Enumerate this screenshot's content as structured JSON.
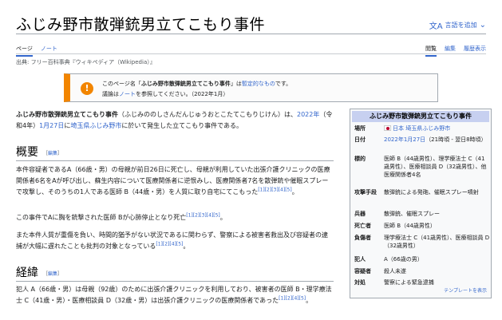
{
  "page": {
    "title": "ふじみ野市散弾銃男立てこもり事件",
    "lang_button": "言語を追加",
    "lang_icon": "translate-icon",
    "tabs_left": [
      "ページ",
      "ノート"
    ],
    "tabs_right": [
      "閲覧",
      "編集",
      "履歴表示"
    ],
    "source": "出典: フリー百科事典『ウィキペディア（Wikipedia）』"
  },
  "notice": {
    "icon": "!",
    "line1_pre": "このページ名「",
    "line1_name": "ふじみ野市散弾銃男立てこもり事件",
    "line1_mid": "」は",
    "line1_link": "暫定的なもの",
    "line1_post": "です。",
    "line2_pre": "議論は",
    "line2_link": "ノート",
    "line2_post": "を参照してください。（2022年1月）"
  },
  "intro": {
    "bold": "ふじみ野市散弾銃男立てこもり事件",
    "reading": "（ふじみののしさんだんじゅうおとこたてこもりじけん）は、",
    "date1": "2022年",
    "era": "（令和4年）",
    "date2": "1月27日",
    "mid": "に",
    "place": "埼玉県ふじみ野市",
    "tail": "に於いて発生した立てこもり事件である。"
  },
  "section1": {
    "heading": "概要",
    "edit_open": "［",
    "edit_label": "編集",
    "edit_close": "］",
    "p1": "本件容疑者であるA（66歳・男）の母親が前日26日に死亡し、母親が利用していた出張介護クリニックの医療関係者6名をAが呼び出し、蘇生内容について医療関係者に逆恨みし、医療関係者7名を散弾銃や催眠スプレーで攻撃し、そのうちの1人である医師 B（44歳・男）を人質に取り自宅にてこもった",
    "p1_refs": "[1][2][3][4][5]",
    "p1_end": "。",
    "p2": "この事件でAに胸を銃撃された医師 Bが心肺停止となり死亡",
    "p2_refs": "[1][2][3][4][5]",
    "p2_end": "。",
    "p3": "また本件人質が重傷を負い、時間的猶予がない状況であるに関わらず、警察による被害者救出及び容疑者の逮捕が大幅に遅れたことも批判の対象となっている",
    "p3_refs": "[1][2][4][5]",
    "p3_end": "。"
  },
  "section2": {
    "heading": "経緯",
    "edit_open": "［",
    "edit_label": "編集",
    "edit_close": "］",
    "p1": "犯人 A（66歳・男）は母親（92歳）のために出張介護クリニックを利用しており、被害者の医師 B・理学療法士 C（41歳・男）・医療相談員 D（32歳・男）は出張介護クリニックの医療関係者であった",
    "p1_refs": "[1][2][4][5]",
    "p1_end": "。"
  },
  "infobox": {
    "title": "ふじみ野市散弾銃男立てこもり事件",
    "rows": [
      {
        "label": "場所",
        "value_link": "日本 埼玉県ふじみ野市"
      },
      {
        "label": "日付",
        "value_link": "2022年1月27日",
        "value_rest": "（21時頃 - 翌日8時頃）"
      },
      {
        "label": "標的",
        "value": "医師 B（44歳男性）、理学療法士 C（41歳男性）、医療相談員 D（32歳男性）、他医療関係者4名"
      },
      {
        "label": "攻撃手段",
        "value": "散弾銃による発砲、催眠スプレー噴射"
      },
      {
        "label": "兵器",
        "value": "散弾銃、催眠スプレー"
      },
      {
        "label": "死亡者",
        "value": "医師 B（44歳男性）"
      },
      {
        "label": "負傷者",
        "value": "理学療法士 C（41歳男性）、医療相談員 D（32歳男性）"
      },
      {
        "label": "犯人",
        "value": "A（66歳の男）"
      },
      {
        "label": "容疑者",
        "value": "殺人未遂"
      },
      {
        "label": "対処",
        "value": "警察による緊急逮捕"
      }
    ],
    "footer": "テンプレートを表示"
  }
}
